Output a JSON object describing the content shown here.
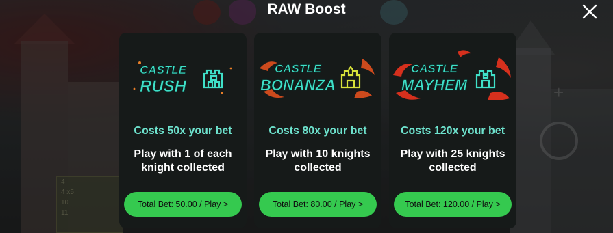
{
  "header": {
    "title": "RAW Boost",
    "close_icon": "close-icon"
  },
  "colors": {
    "card_bg": "#161a19",
    "cost_text": "#6ee3ce",
    "play_button": "#35c94f",
    "rush_logo": "#3fe0c8",
    "bonanza_logo": "#3fe0c8",
    "mayhem_logo": "#3fe0c8"
  },
  "cards": [
    {
      "logo_line1": "CASTLE",
      "logo_line2": "RUSH",
      "logo_icon": "castle-icon",
      "cost": "Costs 50x your bet",
      "description": "Play with 1 of each knight collected",
      "button": "Total Bet: 50.00 / Play >"
    },
    {
      "logo_line1": "CASTLE",
      "logo_line2": "BONANZA",
      "logo_icon": "castle-icon",
      "cost": "Costs 80x your bet",
      "description": "Play with 10 knights collected",
      "button": "Total Bet: 80.00 / Play >"
    },
    {
      "logo_line1": "CASTLE",
      "logo_line2": "MAYHEM",
      "logo_icon": "castle-icon",
      "cost": "Costs 120x your bet",
      "description": "Play with 25 knights collected",
      "button": "Total Bet: 120.00 / Play >"
    }
  ],
  "background": {
    "paytable": [
      "4",
      "4 x5",
      "10",
      "11"
    ]
  }
}
